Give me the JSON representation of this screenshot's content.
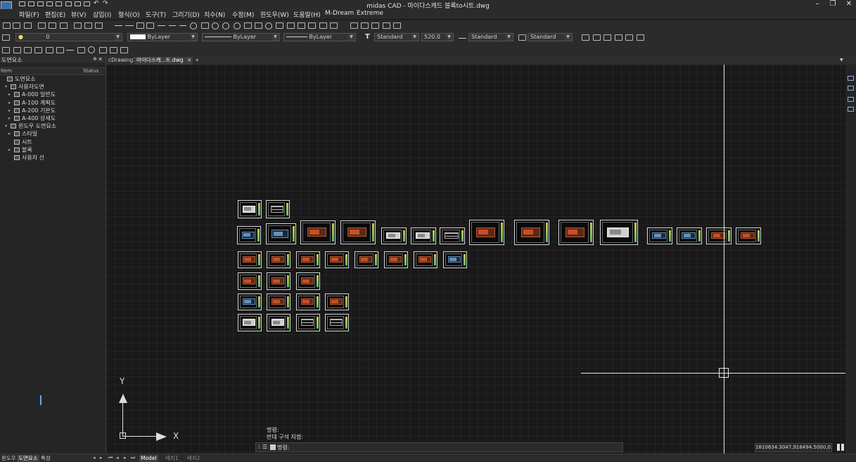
{
  "window": {
    "title": "midas CAD - 마이다스캐드 블록to시트.dwg",
    "minimize_glyph": "–",
    "restore_glyph": "❐",
    "close_glyph": "✕"
  },
  "menu": {
    "items": [
      "파일(F)",
      "편집(E)",
      "뷰(V)",
      "삽입(I)",
      "형식(O)",
      "도구(T)",
      "그리기(D)",
      "치수(N)",
      "수정(M)",
      "윈도우(W)",
      "도움말(H)",
      "M-Dream",
      "Extreme"
    ]
  },
  "properties_bar": {
    "layer_value": "0",
    "color_value": "ByLayer",
    "linetype_value": "ByLayer",
    "lineweight_value": "ByLayer",
    "text_style_value": "Standard",
    "text_height_value": "520.0",
    "dim_style_value": "Standard",
    "leader_style_value": "Standard"
  },
  "left_panel": {
    "title": "도면요소",
    "pin_glyph": "✕",
    "column_item": "Item",
    "column_status": "Status",
    "tree": [
      {
        "label": "도면요소",
        "level": 0,
        "expander": ""
      },
      {
        "label": "사용자도면",
        "level": 1,
        "expander": "▾"
      },
      {
        "label": "A-000 일반도",
        "level": 2,
        "expander": "▸"
      },
      {
        "label": "A-100 계획도",
        "level": 2,
        "expander": "▸"
      },
      {
        "label": "A-200 기본도",
        "level": 2,
        "expander": "▸"
      },
      {
        "label": "A-400 상세도",
        "level": 2,
        "expander": "▸"
      },
      {
        "label": "윈도우 도면요소",
        "level": 1,
        "expander": "▾"
      },
      {
        "label": "스타일",
        "level": 2,
        "expander": "▸"
      },
      {
        "label": "시트",
        "level": 2,
        "expander": ""
      },
      {
        "label": "블록",
        "level": 2,
        "expander": "▸"
      },
      {
        "label": "사용자 선",
        "level": 2,
        "expander": ""
      }
    ]
  },
  "doc_tabs": {
    "tabs": [
      "cDrawing1",
      "마이다스캐...트.dwg"
    ],
    "close_glyph": "✕",
    "add_glyph": "+"
  },
  "ucs": {
    "x_label": "X",
    "y_label": "Y"
  },
  "command": {
    "history": [
      "명령:",
      "반대 구석 지정:"
    ],
    "prompt": "명령:",
    "input_value": ""
  },
  "status": {
    "coordinates": "1810634.3047,918494.5000,0.0000"
  },
  "bottom_tabs": {
    "panel_tabs": [
      "윈도우",
      "도면요소",
      "특성"
    ],
    "layout_tabs": [
      "Model",
      "배치1",
      "배치2"
    ]
  }
}
